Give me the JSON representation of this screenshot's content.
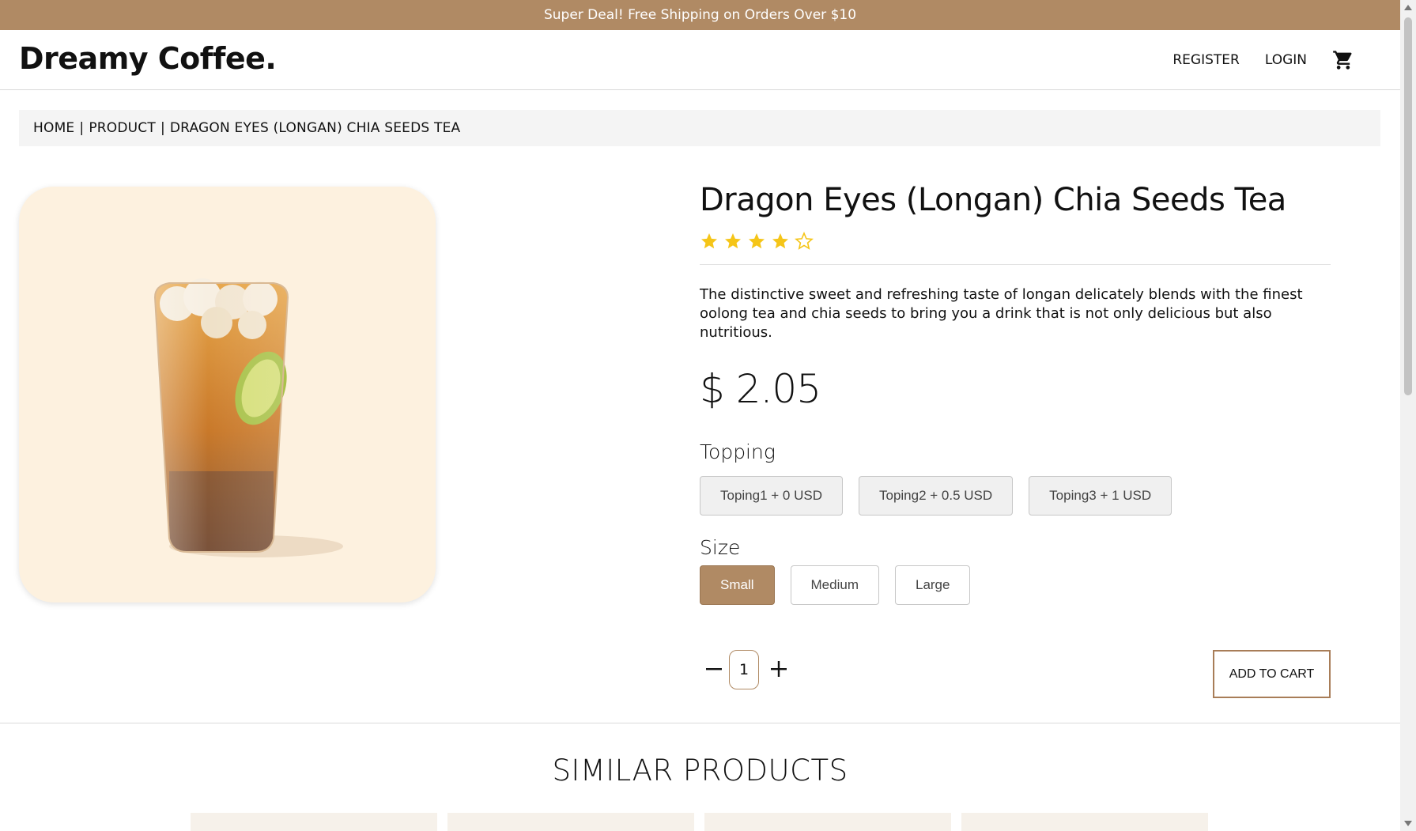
{
  "promo": {
    "text": "Super Deal! Free Shipping on Orders Over $10"
  },
  "header": {
    "brand": "Dreamy Coffee.",
    "register": "REGISTER",
    "login": "LOGIN",
    "cart_icon": "shopping-cart-icon"
  },
  "breadcrumb": {
    "home": "HOME",
    "product": "PRODUCT",
    "current": "DRAGON EYES (LONGAN) CHIA SEEDS TEA",
    "separator": "|"
  },
  "product": {
    "title": "Dragon Eyes (Longan) Chia Seeds Tea",
    "rating": {
      "value": 4,
      "max": 5
    },
    "description": "The distinctive sweet and refreshing taste of longan delicately blends with the finest oolong tea and chia seeds to bring you a drink that is not only delicious but also nutritious.",
    "price": "$ 2.05",
    "topping_label": "Topping",
    "toppings": [
      "Toping1 + 0 USD",
      "Toping2 + 0.5 USD",
      "Toping3 + 1 USD"
    ],
    "size_label": "Size",
    "sizes": [
      "Small",
      "Medium",
      "Large"
    ],
    "selected_size": "Small",
    "quantity": "1",
    "add_to_cart": "ADD TO CART"
  },
  "similar": {
    "title": "SIMILAR PRODUCTS"
  },
  "colors": {
    "brand": "#b08a64",
    "star": "#f5c518",
    "image_bg": "#fdf1df"
  }
}
